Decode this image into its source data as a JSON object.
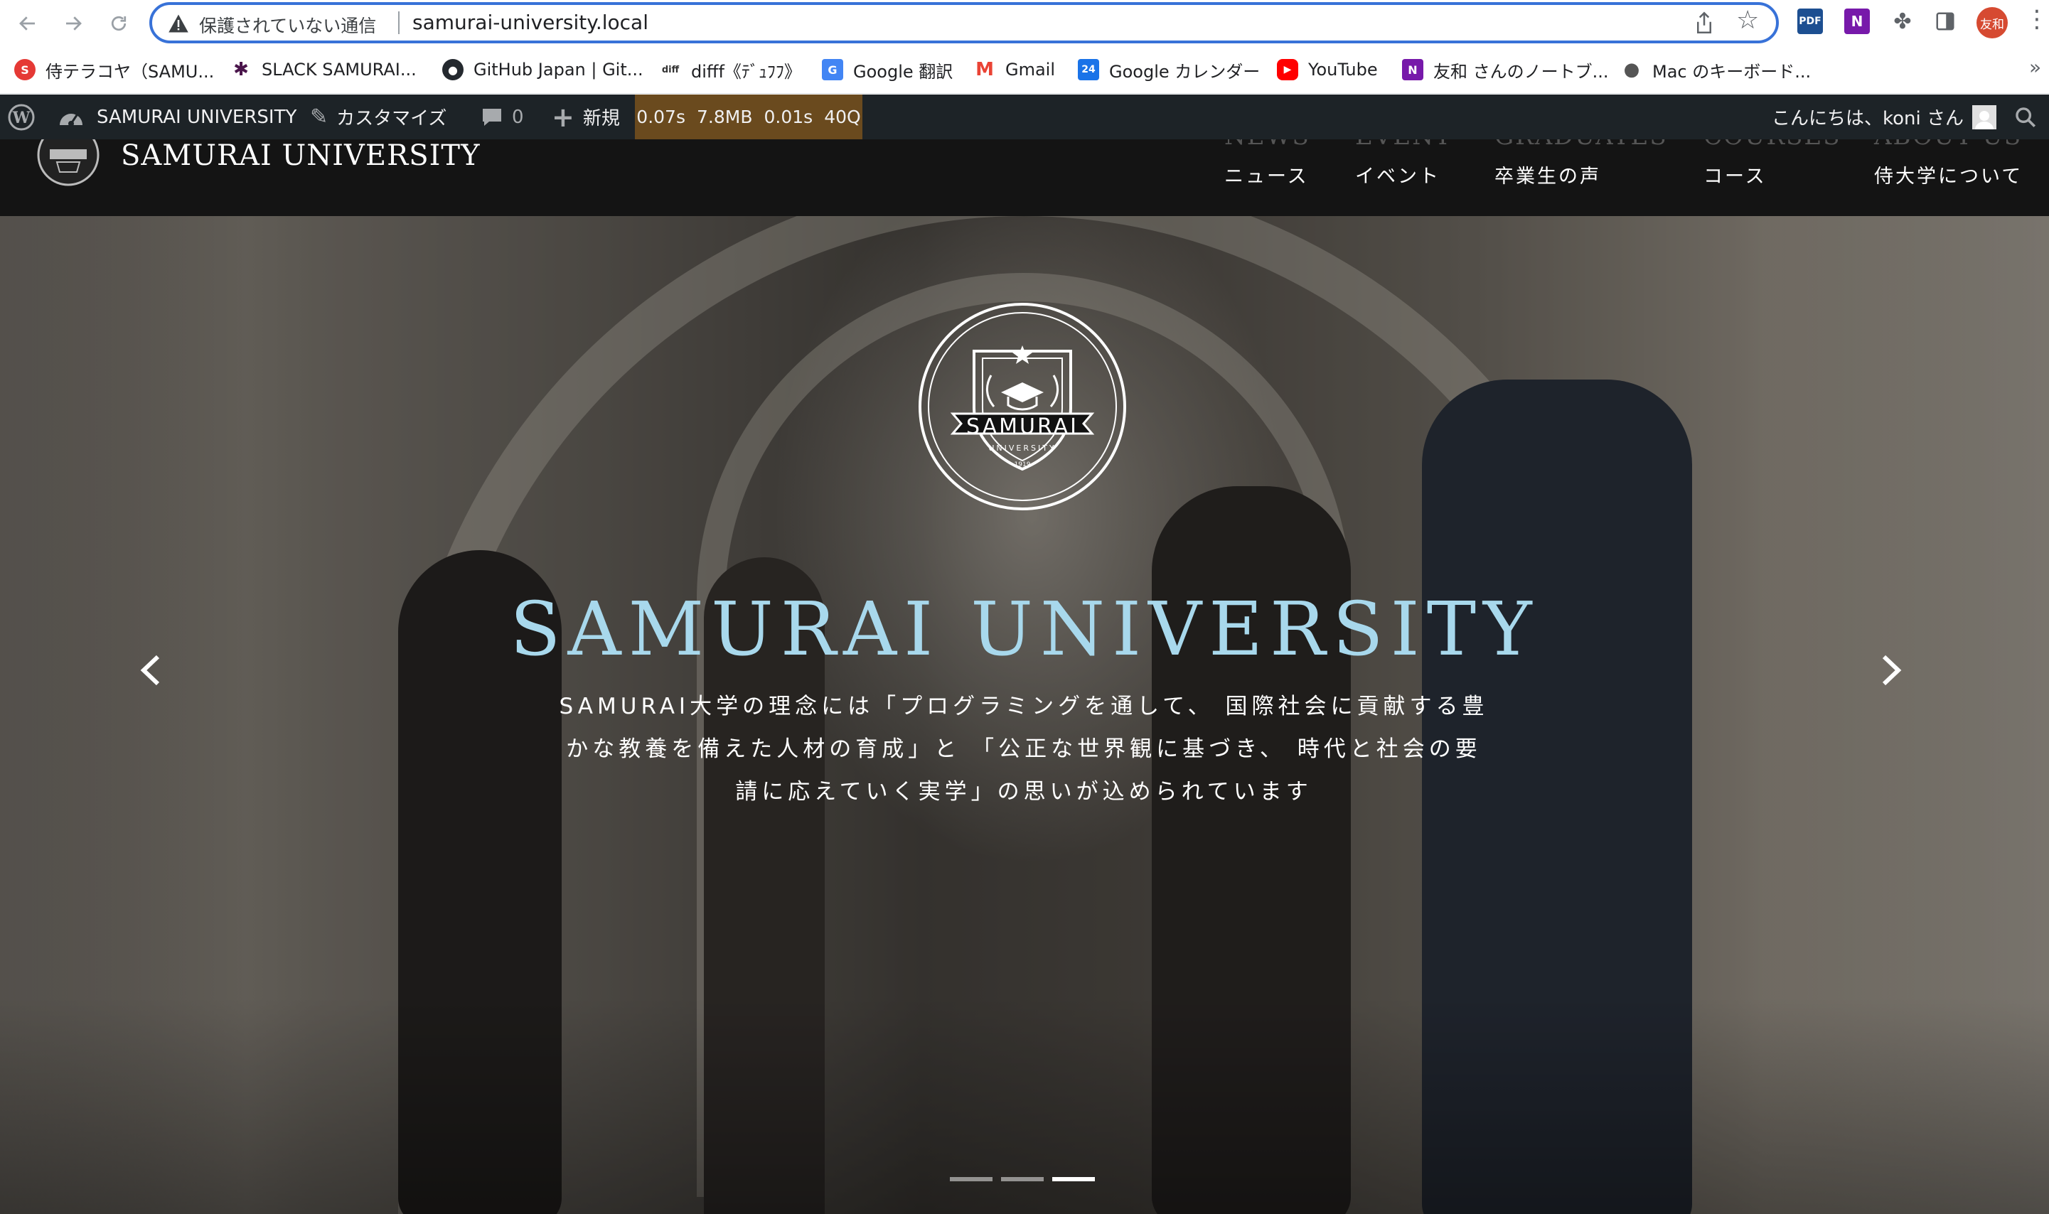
{
  "browser": {
    "security_label": "保護されていない通信",
    "url": "samurai-university.local",
    "profile_initials": "友和",
    "menu_glyph": "⋮"
  },
  "bookmarks": {
    "items": [
      {
        "label": "侍テラコヤ（SAMU...",
        "icon": "samurai-terakoya-icon",
        "color": "#e53935"
      },
      {
        "label": "SLACK SAMURAI...",
        "icon": "slack-icon",
        "color": "#4a154b"
      },
      {
        "label": "GitHub Japan | Git...",
        "icon": "github-icon",
        "color": "#24292f"
      },
      {
        "label": "difff《ﾃﾞｭﾌﾌ》",
        "icon": "difff-icon",
        "color": "#ffffff"
      },
      {
        "label": "Google 翻訳",
        "icon": "google-translate-icon",
        "color": "#4285f4"
      },
      {
        "label": "Gmail",
        "icon": "gmail-icon",
        "color": "#ea4335"
      },
      {
        "label": "Google カレンダー",
        "icon": "google-calendar-icon",
        "color": "#1a73e8"
      },
      {
        "label": "YouTube",
        "icon": "youtube-icon",
        "color": "#ff0000"
      },
      {
        "label": "友和 さんのノートブ...",
        "icon": "onenote-icon",
        "color": "#7719aa"
      },
      {
        "label": "Mac のキーボード...",
        "icon": "apple-icon",
        "color": "#555555"
      }
    ],
    "overflow": "»"
  },
  "adminbar": {
    "site_name": "SAMURAI UNIVERSITY",
    "customize": "カスタマイズ",
    "comments_count": "0",
    "new": "新規",
    "query_monitor": [
      "0.07s",
      "7.8MB",
      "0.01s",
      "40Q"
    ],
    "greeting": "こんにちは、koni さん"
  },
  "site": {
    "title": "SAMURAI UNIVERSITY",
    "nav": [
      {
        "en": "NEWS",
        "jp": "ニュース"
      },
      {
        "en": "EVENT",
        "jp": "イベント"
      },
      {
        "en": "GRADUATES",
        "jp": "卒業生の声"
      },
      {
        "en": "COURSES",
        "jp": "コース"
      },
      {
        "en": "ABOUT US",
        "jp": "侍大学について"
      }
    ]
  },
  "hero": {
    "emblem_text": "SAMURAI",
    "emblem_sub": "UNIVERSITY",
    "emblem_year": "1919",
    "title": "SAMURAI UNIVERSITY",
    "lines": [
      "SAMURAI大学の理念には「プログラミングを通して、 国際社会に貢献する豊",
      "かな教養を備えた人材の育成」と 「公正な世界観に基づき、 時代と社会の要",
      "請に応えていく実学」の思いが込められています"
    ],
    "prev_glyph": "‹",
    "next_glyph": "›",
    "slide_count": 3,
    "active_slide": 3
  },
  "colors": {
    "accent": "#3872d8",
    "adminbar": "#1d2327",
    "query_monitor": "#6a4a1e",
    "hero_title": "#a8d8ec"
  }
}
